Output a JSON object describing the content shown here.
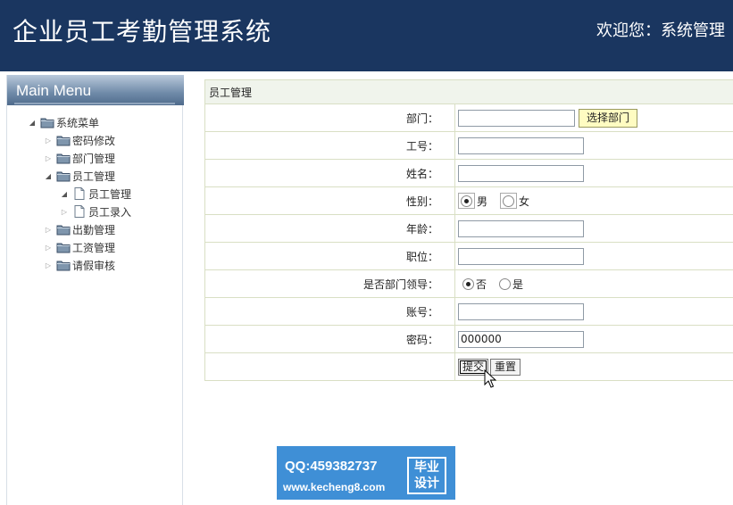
{
  "header": {
    "title": "企业员工考勤管理系统",
    "welcome": "欢迎您：系统管理"
  },
  "sidebar": {
    "menu_title": "Main Menu",
    "tree": [
      {
        "label": "系统菜单",
        "icon": "folder-icon",
        "state": "expanded",
        "level": 0
      },
      {
        "label": "密码修改",
        "icon": "folder-icon",
        "state": "collapsed",
        "level": 1
      },
      {
        "label": "部门管理",
        "icon": "folder-icon",
        "state": "collapsed",
        "level": 1
      },
      {
        "label": "员工管理",
        "icon": "folder-icon",
        "state": "expanded",
        "level": 1
      },
      {
        "label": "员工管理",
        "icon": "document-icon",
        "state": "expanded",
        "level": 2
      },
      {
        "label": "员工录入",
        "icon": "document-icon",
        "state": "collapsed",
        "level": 2
      },
      {
        "label": "出勤管理",
        "icon": "folder-icon",
        "state": "collapsed",
        "level": 1
      },
      {
        "label": "工资管理",
        "icon": "folder-icon",
        "state": "collapsed",
        "level": 1
      },
      {
        "label": "请假审核",
        "icon": "folder-icon",
        "state": "collapsed",
        "level": 1
      }
    ]
  },
  "form": {
    "section_title": "员工管理",
    "department": {
      "label": "部门：",
      "value": "",
      "pick_button": "选择部门"
    },
    "emp_no": {
      "label": "工号：",
      "value": ""
    },
    "name": {
      "label": "姓名：",
      "value": ""
    },
    "gender": {
      "label": "性别：",
      "options": [
        "男",
        "女"
      ],
      "selected": "男"
    },
    "age": {
      "label": "年龄：",
      "value": ""
    },
    "position": {
      "label": "职位：",
      "value": ""
    },
    "is_leader": {
      "label": "是否部门领导：",
      "options": [
        "否",
        "是"
      ],
      "selected": "否"
    },
    "account": {
      "label": "账号：",
      "value": ""
    },
    "password": {
      "label": "密码：",
      "value": "000000"
    },
    "submit_label": "提交",
    "reset_label": "重置"
  },
  "banner": {
    "qq": "QQ:459382737",
    "url": "www.kecheng8.com",
    "badge_line1": "毕业",
    "badge_line2": "设计"
  },
  "colors": {
    "header_bg": "#1a3660",
    "pick_button_bg": "#fffcc2",
    "banner_bg": "#3f8fd6"
  }
}
